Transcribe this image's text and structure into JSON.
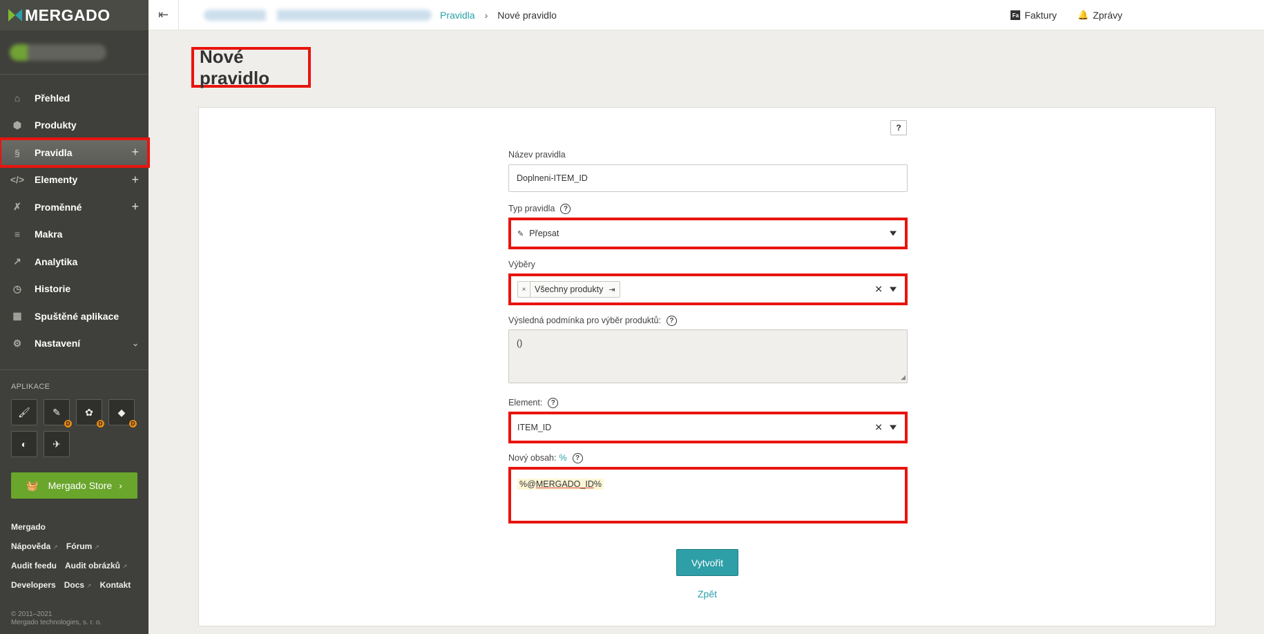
{
  "sidebar": {
    "brand": "MERGADO",
    "nav": [
      {
        "label": "Přehled",
        "icon": "home-icon",
        "glyph": "⌂"
      },
      {
        "label": "Produkty",
        "icon": "box-icon",
        "glyph": "⬢"
      },
      {
        "label": "Pravidla",
        "icon": "paragraph-icon",
        "glyph": "§",
        "active": true,
        "action": "+"
      },
      {
        "label": "Elementy",
        "icon": "code-icon",
        "glyph": "</>",
        "action": "+"
      },
      {
        "label": "Proměnné",
        "icon": "variable-icon",
        "glyph": "✗",
        "action": "+"
      },
      {
        "label": "Makra",
        "icon": "list-icon",
        "glyph": "≡"
      },
      {
        "label": "Analytika",
        "icon": "chart-icon",
        "glyph": "↗"
      },
      {
        "label": "Historie",
        "icon": "clock-icon",
        "glyph": "◷"
      },
      {
        "label": "Spuštěné aplikace",
        "icon": "grid-icon",
        "glyph": "▦"
      },
      {
        "label": "Nastavení",
        "icon": "gear-icon",
        "glyph": "⚙",
        "chevron": "⌄"
      }
    ],
    "apps_title": "APLIKACE",
    "apps": [
      {
        "icon": "brush-app-icon",
        "glyph": "🖌",
        "badge": ""
      },
      {
        "icon": "map-app-icon",
        "glyph": "✎",
        "badge": "D"
      },
      {
        "icon": "hedgehog-app-icon",
        "glyph": "✿",
        "badge": "D"
      },
      {
        "icon": "fox-app-icon",
        "glyph": "◆",
        "badge": "D"
      },
      {
        "icon": "coin-app-icon",
        "glyph": "◐",
        "badge": ""
      },
      {
        "icon": "plane-app-icon",
        "glyph": "✈",
        "badge": ""
      }
    ],
    "store_label": "Mergado Store",
    "footer_brand": "Mergado",
    "footer_links": [
      {
        "label": "Nápověda",
        "ext": true
      },
      {
        "label": "Fórum",
        "ext": true
      },
      {
        "label": "Audit feedu",
        "ext": false
      },
      {
        "label": "Audit obrázků",
        "ext": true
      },
      {
        "label": "Developers",
        "ext": false
      },
      {
        "label": "Docs",
        "ext": true
      },
      {
        "label": "Kontakt",
        "ext": false
      }
    ],
    "copyright_1": "© 2011–2021",
    "copyright_2": "Mergado technologies, s. r. o."
  },
  "topbar": {
    "crumb_link": "Pravidla",
    "crumb_sep": "›",
    "crumb_current": "Nové pravidlo",
    "invoices": "Faktury",
    "invoices_badge": "Fa",
    "messages": "Zprávy"
  },
  "page": {
    "title": "Nové pravidlo",
    "help": "?"
  },
  "form": {
    "name_label": "Název pravidla",
    "name_value": "Doplneni-ITEM_ID",
    "type_label": "Typ pravidla",
    "type_value": "Přepsat",
    "selections_label": "Výběry",
    "selection_tag": "Všechny produkty",
    "condition_label": "Výsledná podmínka pro výběr produktů:",
    "condition_value": "()",
    "element_label": "Element:",
    "element_value": "ITEM_ID",
    "content_label": "Nový obsah:",
    "content_pct": "%",
    "content_prefix": "%@",
    "content_var": "MERGADO_ID",
    "content_suffix": "%",
    "submit": "Vytvořit",
    "back": "Zpět"
  },
  "colors": {
    "accent": "#2e9ea7",
    "sidebar": "#3f3f3b",
    "highlight": "#e8140e",
    "store": "#6aa52c"
  }
}
